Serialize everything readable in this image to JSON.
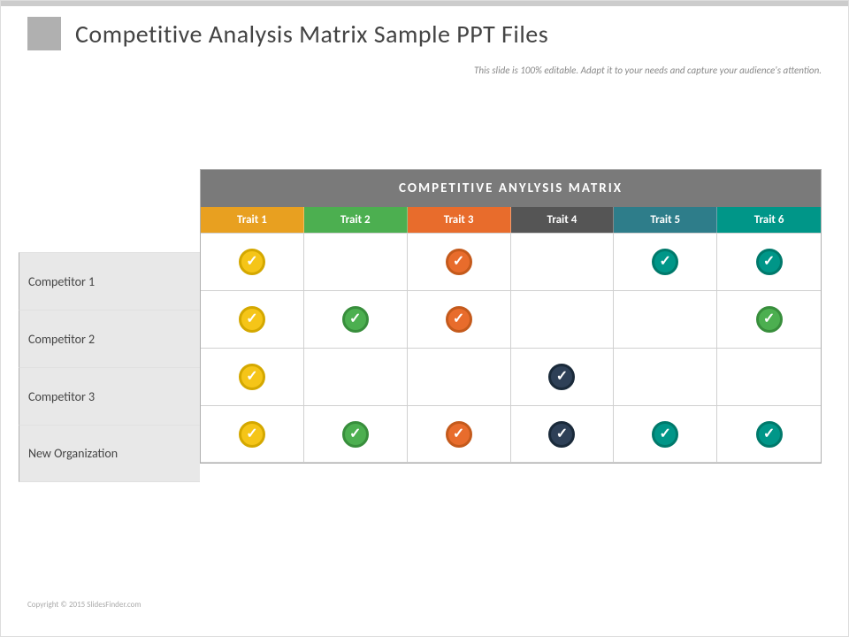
{
  "page": {
    "title": "Competitive Analysis Matrix Sample PPT Files",
    "subtitle": "This slide is 100% editable. Adapt it to your needs and capture your audience's attention.",
    "watermark": "Copyright © 2015 SlidesFinder.com",
    "matrix": {
      "header": "COMPETITIVE ANYLYSIS MATRIX",
      "traits": [
        {
          "label": "Trait 1",
          "color": "#e8a020"
        },
        {
          "label": "Trait 2",
          "color": "#4caf50"
        },
        {
          "label": "Trait 3",
          "color": "#e86c2c"
        },
        {
          "label": "Trait 4",
          "color": "#555555"
        },
        {
          "label": "Trait 5",
          "color": "#2e7d8a"
        },
        {
          "label": "Trait 6",
          "color": "#009688"
        }
      ],
      "rows": [
        {
          "label": "Competitor 1",
          "checks": [
            {
              "has": true,
              "type": "yellow"
            },
            {
              "has": false
            },
            {
              "has": true,
              "type": "orange"
            },
            {
              "has": false
            },
            {
              "has": true,
              "type": "teal"
            },
            {
              "has": true,
              "type": "teal"
            }
          ]
        },
        {
          "label": "Competitor 2",
          "checks": [
            {
              "has": true,
              "type": "yellow"
            },
            {
              "has": true,
              "type": "green"
            },
            {
              "has": true,
              "type": "orange"
            },
            {
              "has": false
            },
            {
              "has": false
            },
            {
              "has": true,
              "type": "green"
            }
          ]
        },
        {
          "label": "Competitor 3",
          "checks": [
            {
              "has": true,
              "type": "yellow"
            },
            {
              "has": false
            },
            {
              "has": false
            },
            {
              "has": true,
              "type": "dark"
            },
            {
              "has": false
            },
            {
              "has": false
            }
          ]
        },
        {
          "label": "New Organization",
          "checks": [
            {
              "has": true,
              "type": "yellow"
            },
            {
              "has": true,
              "type": "green"
            },
            {
              "has": true,
              "type": "orange"
            },
            {
              "has": true,
              "type": "dark"
            },
            {
              "has": true,
              "type": "teal"
            },
            {
              "has": true,
              "type": "teal"
            }
          ]
        }
      ]
    }
  }
}
